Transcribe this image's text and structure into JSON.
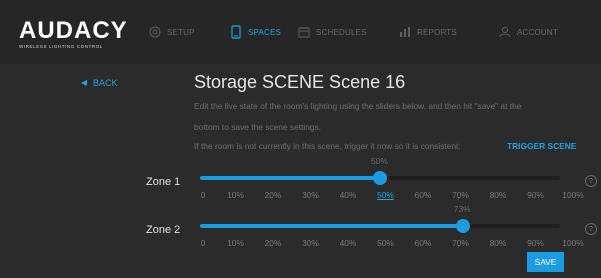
{
  "brand": {
    "name": "AUDACY",
    "tagline": "WIRELESS LIGHTING CONTROL"
  },
  "nav": {
    "items": [
      {
        "label": "SETUP",
        "icon": "gear-icon",
        "active": false
      },
      {
        "label": "SPACES",
        "icon": "phone-icon",
        "active": true
      },
      {
        "label": "SCHEDULES",
        "icon": "calendar-icon",
        "active": false
      },
      {
        "label": "REPORTS",
        "icon": "bar-chart-icon",
        "active": false
      },
      {
        "label": "ACCOUNT",
        "icon": "user-icon",
        "active": false
      }
    ]
  },
  "back": {
    "label": "BACK",
    "icon": "triangle-left-icon"
  },
  "page": {
    "title": "Storage SCENE Scene 16",
    "line1": "Edit the live state of the room's lighting using the sliders below, and then hit \"save\" at the",
    "line2": "bottom to save the scene settings.",
    "line3": "If the room is not currently in this scene, trigger it now so it is consistent:",
    "trigger": "TRIGGER SCENE"
  },
  "zones": [
    {
      "label": "Zone 1",
      "value_label": "50%",
      "value": 50
    },
    {
      "label": "Zone 2",
      "value_label": "73%",
      "value": 73
    }
  ],
  "ticks": [
    "0",
    "10%",
    "20%",
    "30%",
    "40%",
    "50%",
    "60%",
    "70%",
    "80%",
    "90%",
    "100%"
  ],
  "save": "SAVE",
  "colors": {
    "accent": "#1b9be0",
    "background": "#2b2b2b",
    "topbar": "#262626"
  }
}
